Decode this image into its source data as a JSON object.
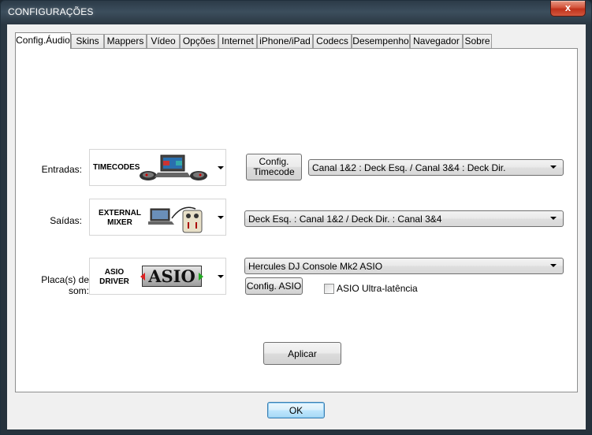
{
  "window": {
    "title": "CONFIGURAÇÕES",
    "close_glyph": "x"
  },
  "tabs": [
    {
      "label": "Config.Áudio",
      "active": true
    },
    {
      "label": "Skins"
    },
    {
      "label": "Mappers"
    },
    {
      "label": "Vídeo"
    },
    {
      "label": "Opções"
    },
    {
      "label": "Internet"
    },
    {
      "label": "iPhone/iPad"
    },
    {
      "label": "Codecs"
    },
    {
      "label": "Desempenho"
    },
    {
      "label": "Navegador"
    },
    {
      "label": "Sobre"
    }
  ],
  "inputs": {
    "label": "Entradas:",
    "image_text": "TIMECODES",
    "config_button": "Config. Timecode",
    "routing": "Canal 1&2 : Deck Esq. / Canal 3&4 : Deck Dir."
  },
  "outputs": {
    "label": "Saídas:",
    "image_text": "EXTERNAL MIXER",
    "routing": "Deck Esq. : Canal 1&2 / Deck Dir. : Canal 3&4"
  },
  "soundcard": {
    "label": "Placa(s) de som:",
    "image_text": "ASIO DRIVER",
    "logo_text": "ASIO",
    "device": "Hercules DJ Console Mk2 ASIO",
    "config_button": "Config. ASIO",
    "ultra_latency_label": "ASIO Ultra-latência",
    "ultra_latency_checked": false
  },
  "apply_button": "Aplicar",
  "ok_button": "OK",
  "colors": {
    "close_red": "#c0321c",
    "ok_blue": "#3c7fb1"
  }
}
